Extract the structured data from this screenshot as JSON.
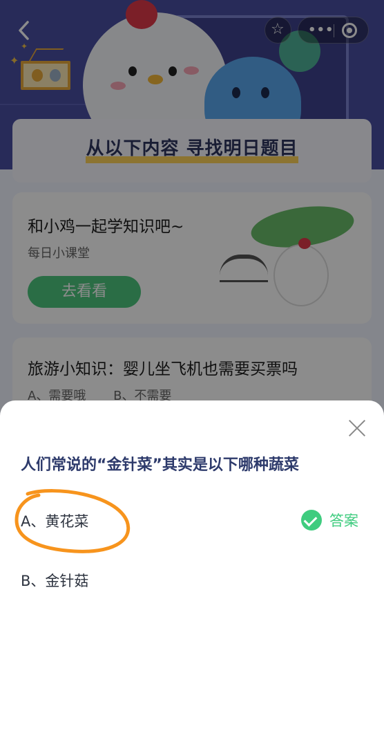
{
  "nav": {
    "back_icon": "chevron-left-icon",
    "more_label": "•••"
  },
  "hero": {
    "section_title": "从以下内容 寻找明日题目"
  },
  "lesson_card": {
    "title": "和小鸡一起学知识吧~",
    "subtitle": "每日小课堂",
    "button_label": "去看看"
  },
  "travel_card": {
    "title": "旅游小知识：婴儿坐飞机也需要买票吗",
    "option_a": "A、需要哦",
    "option_b": "B、不需要"
  },
  "sheet": {
    "question": "人们常说的“金针菜”其实是以下哪种蔬菜",
    "option_a": "A、黄花菜",
    "option_b": "B、金针菇",
    "answer_label": "答案"
  },
  "colors": {
    "accent_green": "#3fcc7f",
    "question_navy": "#2d3a6b",
    "highlight_orange": "#f7941d",
    "hero_purple": "#4a4fa3"
  }
}
